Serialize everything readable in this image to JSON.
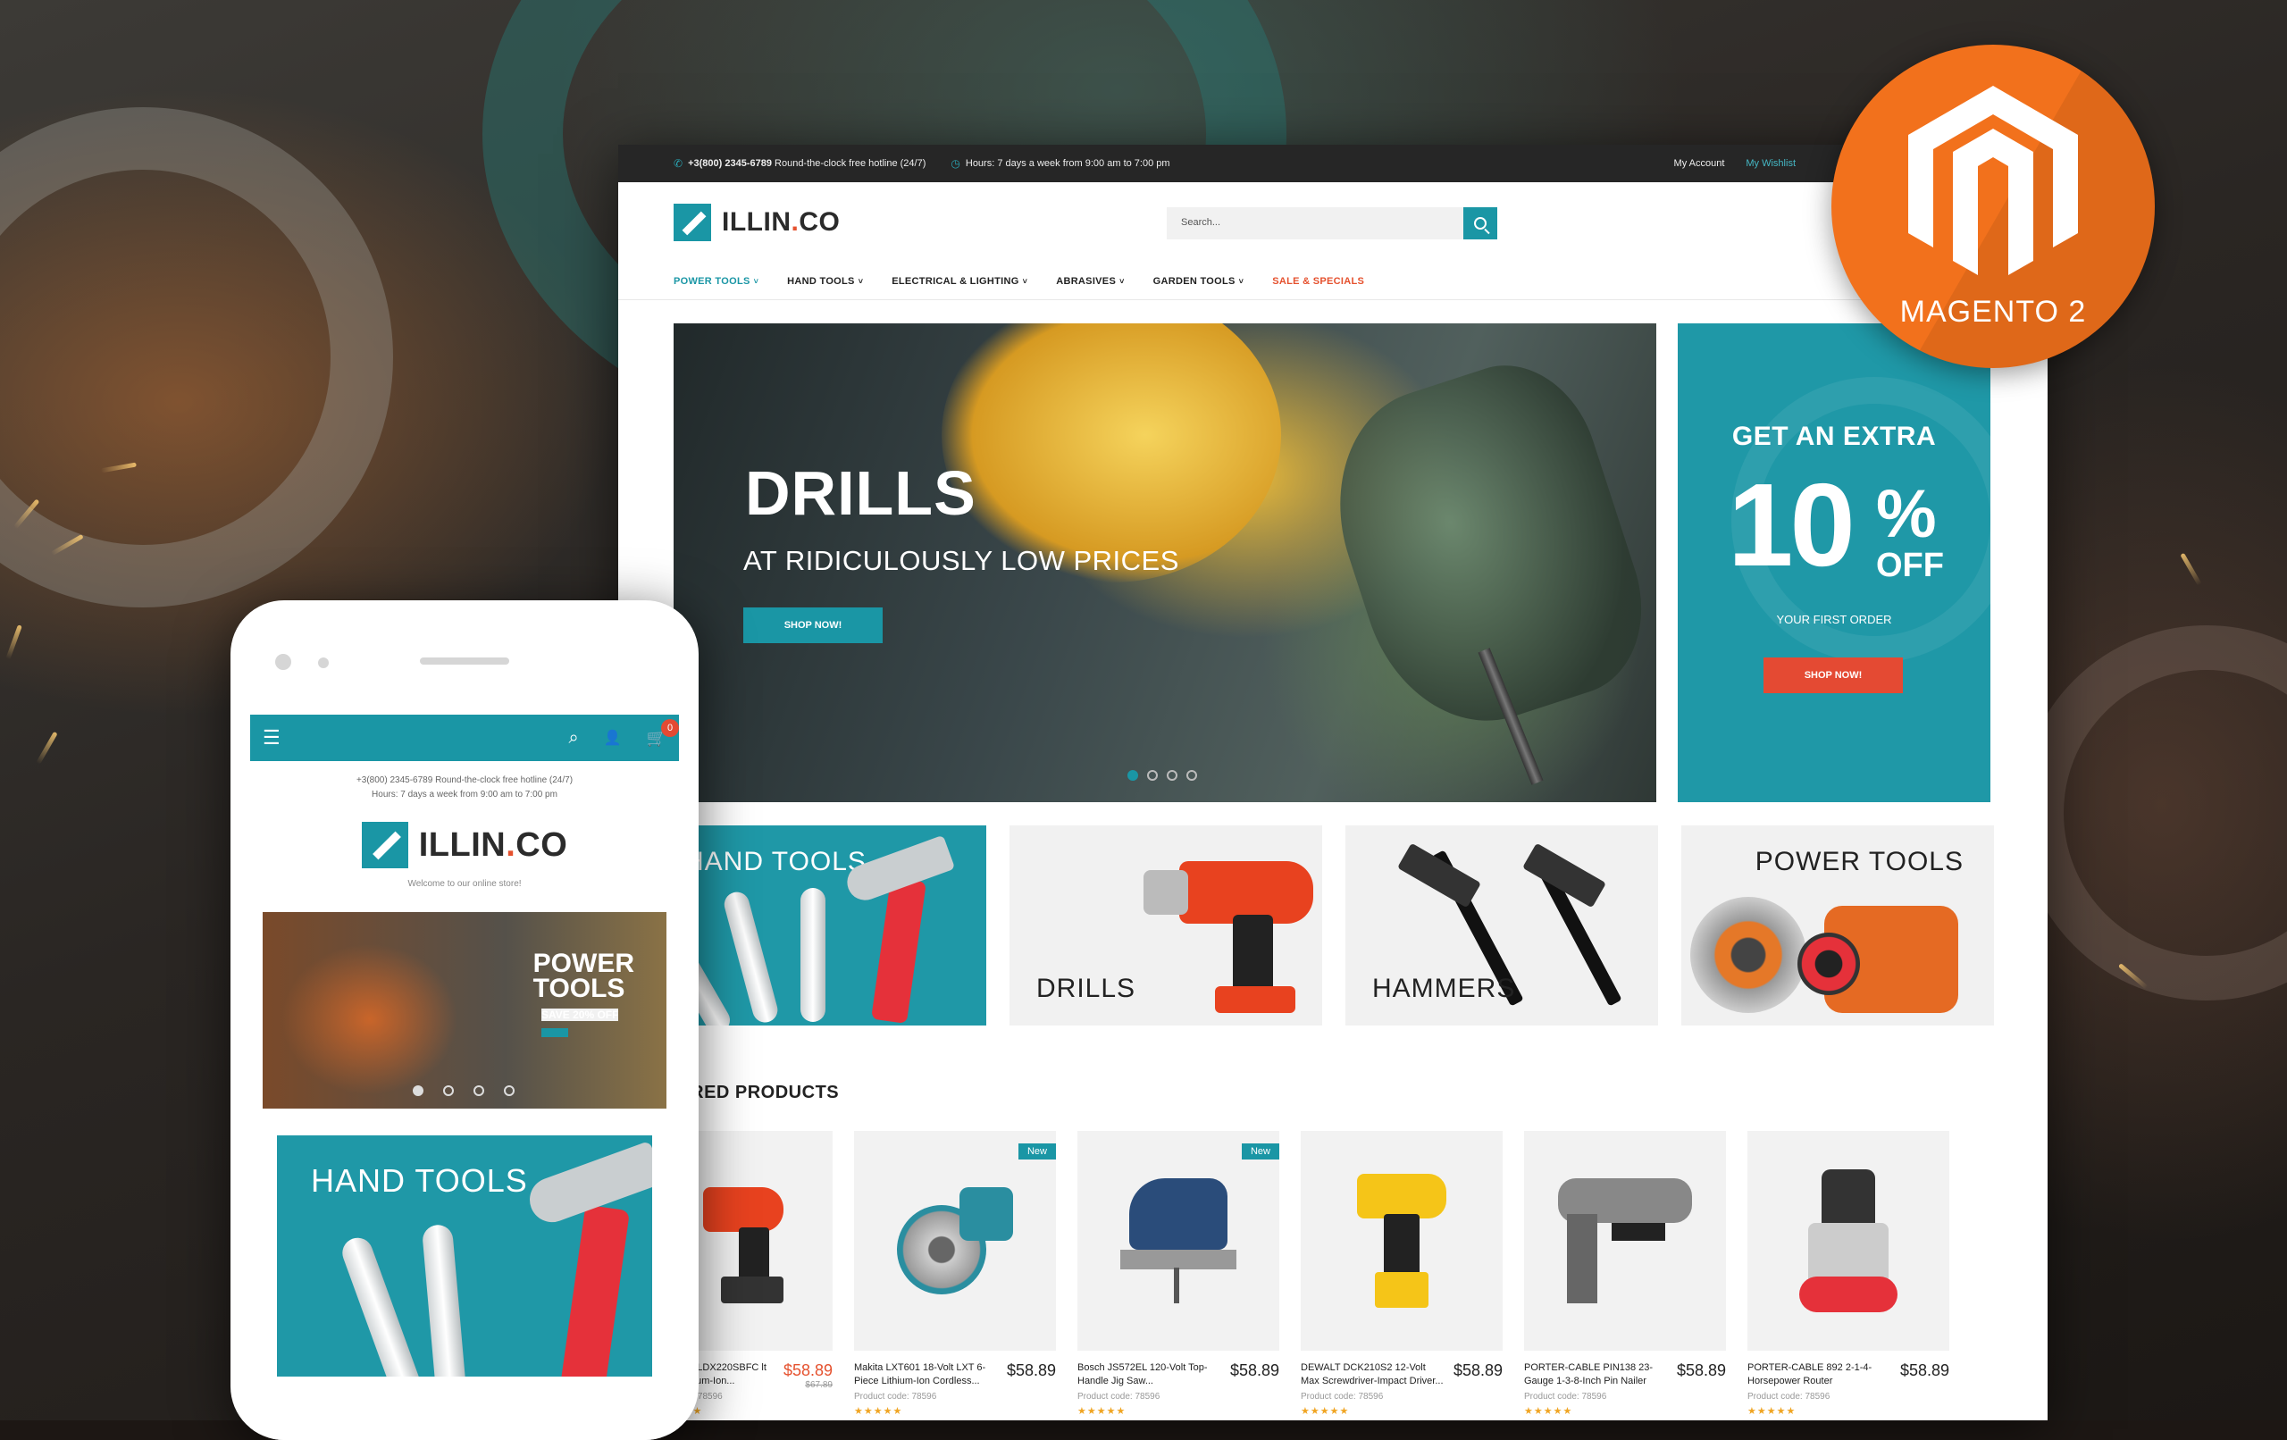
{
  "topbar": {
    "phone": "+3(800) 2345-6789",
    "phone_note": "Round-the-clock free hotline (24/7)",
    "hours": "Hours: 7 days a week from 9:00 am to 7:00 pm",
    "my_account": "My Account",
    "my_wishlist": "My Wishlist"
  },
  "brand": {
    "name": "ILLIN",
    "dot": ".",
    "suffix": "CO"
  },
  "search": {
    "placeholder": "Search..."
  },
  "header": {
    "welcome": "We"
  },
  "nav": [
    {
      "label": "POWER TOOLS",
      "caret": "˅"
    },
    {
      "label": "HAND TOOLS",
      "caret": "˅"
    },
    {
      "label": "ELECTRICAL & LIGHTING",
      "caret": "˅"
    },
    {
      "label": "ABRASIVES",
      "caret": "˅"
    },
    {
      "label": "GARDEN TOOLS",
      "caret": "˅"
    },
    {
      "label": "SALE & SPECIALS"
    }
  ],
  "hero": {
    "title": "DRILLS",
    "subtitle": "AT RIDICULOUSLY LOW PRICES",
    "button": "SHOP NOW!",
    "slide_count": 4,
    "active_slide": 1
  },
  "promo": {
    "line1": "GET AN EXTRA",
    "value": "10",
    "percent": "%",
    "off": "OFF",
    "line2": "YOUR FIRST ORDER",
    "button": "SHOP NOW!"
  },
  "categories": [
    {
      "label": "HAND TOOLS"
    },
    {
      "label": "DRILLS"
    },
    {
      "label": "HAMMERS"
    },
    {
      "label": "POWER TOOLS"
    }
  ],
  "featured": {
    "title": "ATURED PRODUCTS",
    "products": [
      {
        "name": "& Decker LDX220SBFC lt MAX Lithium-Ion...",
        "code": "duct code: 78596",
        "price": "$58.89",
        "old_price": "$67.89",
        "badge": "",
        "stars": "★★★★★"
      },
      {
        "name": "Makita LXT601 18-Volt LXT 6-Piece Lithium-Ion Cordless...",
        "code": "Product code: 78596",
        "price": "$58.89",
        "badge": "New",
        "stars": "★★★★★"
      },
      {
        "name": "Bosch JS572EL 120-Volt Top-Handle Jig Saw...",
        "code": "Product code: 78596",
        "price": "$58.89",
        "badge": "New",
        "stars": "★★★★★"
      },
      {
        "name": "DEWALT DCK210S2 12-Volt Max Screwdriver-Impact Driver...",
        "code": "Product code: 78596",
        "price": "$58.89",
        "badge": "",
        "stars": "★★★★★"
      },
      {
        "name": "PORTER-CABLE PIN138 23-Gauge 1-3-8-Inch Pin Nailer",
        "code": "Product code: 78596",
        "price": "$58.89",
        "badge": "",
        "stars": "★★★★★"
      },
      {
        "name": "PORTER-CABLE 892 2-1-4-Horsepower Router",
        "code": "Product code: 78596",
        "price": "$58.89",
        "badge": "",
        "stars": "★★★★★"
      }
    ]
  },
  "mobile": {
    "menu_icon": "☰",
    "search_icon": "⌕",
    "user_icon": "👤",
    "cart_icon": "🛒",
    "cart_count": "0",
    "phone_line": "+3(800) 2345-6789 Round-the-clock free hotline (24/7)",
    "hours_line": "Hours: 7 days a week from 9:00 am to 7:00 pm",
    "welcome": "Welcome to our online store!",
    "hero_title_1": "POWER",
    "hero_title_2": "TOOLS",
    "hero_sub": "SAVE 20% OFF",
    "tile_label": "HAND TOOLS"
  },
  "badge": {
    "label": "MAGENTO 2"
  },
  "colors": {
    "teal": "#1a96a5",
    "orange": "#f2711c",
    "red": "#e44a33",
    "dark": "#262626"
  }
}
